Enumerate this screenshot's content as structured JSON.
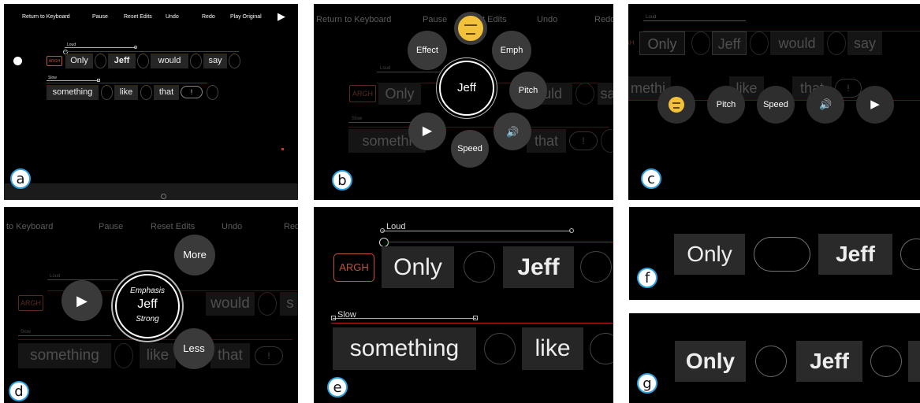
{
  "labels": {
    "a": "a",
    "b": "b",
    "c": "c",
    "d": "d",
    "e": "e",
    "f": "f",
    "g": "g"
  },
  "toolbar": {
    "return": "Return to Keyboard",
    "pause": "Pause",
    "reset": "Reset Edits",
    "undo": "Undo",
    "redo": "Redo",
    "play_original": "Play Original",
    "play_icon": "▶"
  },
  "toolbar_b": {
    "return": "Return to Keyboard",
    "pause": "Pause",
    "reset": "t Edits",
    "undo": "Undo",
    "redo": "Redo"
  },
  "toolbar_d": {
    "return": "to Keyboard",
    "pause": "Pause",
    "reset": "Reset Edits",
    "undo": "Undo",
    "redo": "Red"
  },
  "words": {
    "argh": "ARGH",
    "only": "Only",
    "jeff": "Jeff",
    "would": "would",
    "say": "say",
    "something": "something",
    "like": "like",
    "that": "that",
    "bang": "!",
    "somethi": "somethi",
    "methi": "methi",
    "uld": "uld",
    "s": "s",
    "sa": "sa"
  },
  "annotations": {
    "loud": "Loud",
    "slow": "Slow"
  },
  "radial_b": {
    "effect": "Effect",
    "emph": "Emph",
    "pitch": "Pitch",
    "speed": "Speed",
    "center": "Jeff",
    "emoji_icon": "annoyed-face-icon",
    "speaker_icon": "speaker-icon",
    "play_icon": "▶"
  },
  "radial_c": {
    "pitch": "Pitch",
    "speed": "Speed",
    "play_icon": "▶",
    "speaker_icon": "speaker-icon"
  },
  "radial_d": {
    "more": "More",
    "less": "Less",
    "title": "Emphasis",
    "word": "Jeff",
    "value": "Strong",
    "play_icon": "▶"
  },
  "colors": {
    "badge_border": "#2f9fdc",
    "emoji": "#f2c23a",
    "red_line": "#9b1b1b",
    "argh": "#c0543a"
  }
}
